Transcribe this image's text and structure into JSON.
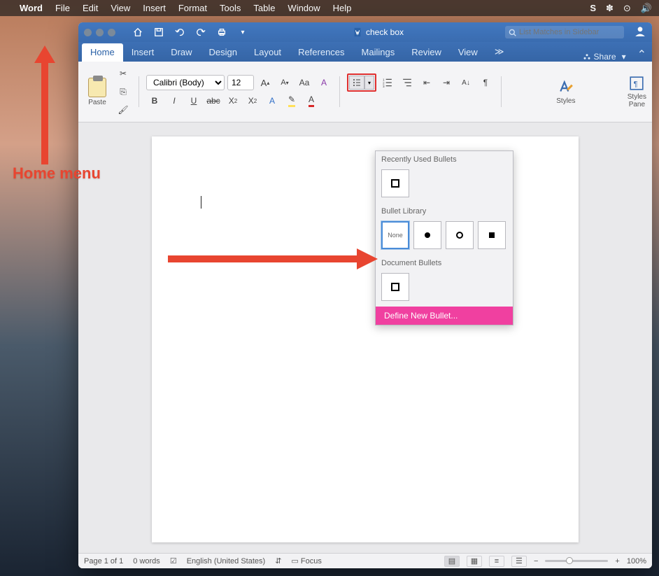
{
  "os_menubar": {
    "app_name": "Word",
    "items": [
      "File",
      "Edit",
      "View",
      "Insert",
      "Format",
      "Tools",
      "Table",
      "Window",
      "Help"
    ]
  },
  "window": {
    "title": "check box",
    "search_placeholder": "List Matches in Sidebar"
  },
  "tabs": {
    "items": [
      "Home",
      "Insert",
      "Draw",
      "Design",
      "Layout",
      "References",
      "Mailings",
      "Review",
      "View"
    ],
    "active": "Home",
    "share_label": "Share"
  },
  "ribbon": {
    "paste_label": "Paste",
    "font_name": "Calibri (Body)",
    "font_size": "12",
    "styles_label": "Styles",
    "styles_pane_label": "Styles\nPane"
  },
  "bullet_dropdown": {
    "recent_hdr": "Recently Used Bullets",
    "library_hdr": "Bullet Library",
    "none_label": "None",
    "document_hdr": "Document Bullets",
    "define_label": "Define New Bullet..."
  },
  "statusbar": {
    "page": "Page 1 of 1",
    "words": "0 words",
    "lang": "English (United States)",
    "focus": "Focus",
    "zoom": "100%"
  },
  "annotation": {
    "label": "Home menu"
  }
}
